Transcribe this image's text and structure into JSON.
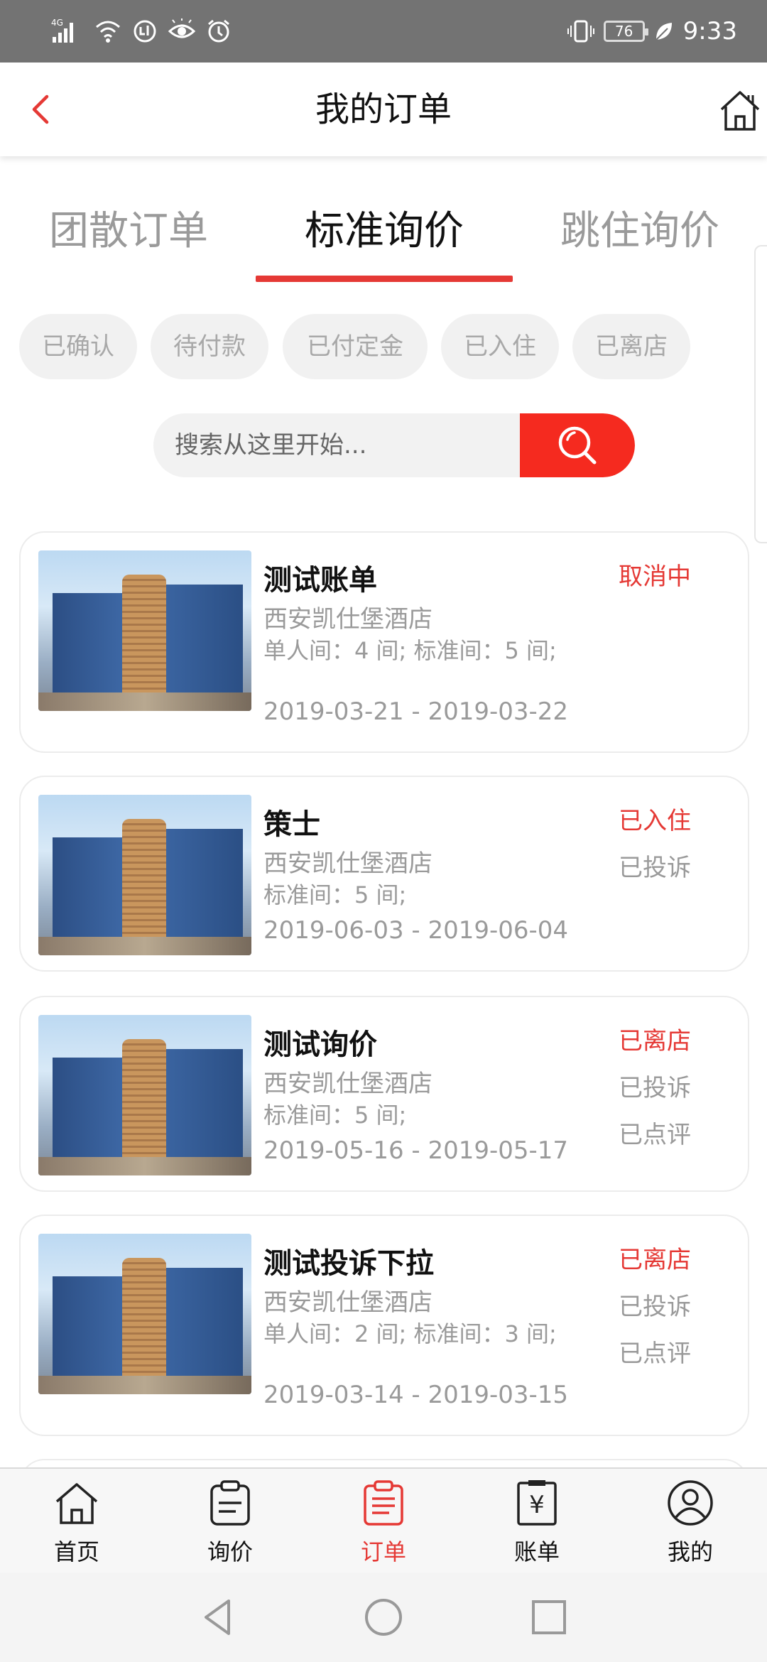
{
  "status_bar": {
    "network": "4G",
    "battery": "76",
    "time": "9:33",
    "icons": [
      "signal-icon",
      "wifi-icon",
      "data-saver-icon",
      "eye-comfort-icon",
      "alarm-icon",
      "vibrate-icon",
      "battery-icon",
      "leaf-icon"
    ]
  },
  "header": {
    "title": "我的订单",
    "back_icon": "back-arrow-icon",
    "home_icon": "home-icon"
  },
  "tabs": [
    {
      "label": "团散订单",
      "active": false
    },
    {
      "label": "标准询价",
      "active": true
    },
    {
      "label": "跳住询价",
      "active": false
    }
  ],
  "filters": [
    "已确认",
    "待付款",
    "已付定金",
    "已入住",
    "已离店"
  ],
  "search": {
    "placeholder": "搜索从这里开始...",
    "button_icon": "search-icon"
  },
  "orders": [
    {
      "title": "测试账单",
      "hotel": "西安凯仕堡酒店",
      "rooms": "单人间：4 间; 标准间：5 间;",
      "dates": "2019-03-21 - 2019-03-22",
      "status": [
        "取消中"
      ]
    },
    {
      "title": "策士",
      "hotel": "西安凯仕堡酒店",
      "rooms": "标准间：5 间;",
      "dates": "2019-06-03 - 2019-06-04",
      "status": [
        "已入住",
        "已投诉"
      ]
    },
    {
      "title": "测试询价",
      "hotel": "西安凯仕堡酒店",
      "rooms": "标准间：5 间;",
      "dates": "2019-05-16 - 2019-05-17",
      "status": [
        "已离店",
        "已投诉",
        "已点评"
      ]
    },
    {
      "title": "测试投诉下拉",
      "hotel": "西安凯仕堡酒店",
      "rooms": "单人间：2 间; 标准间：3 间;",
      "dates": "2019-03-14 - 2019-03-15",
      "status": [
        "已离店",
        "已投诉",
        "已点评"
      ]
    }
  ],
  "bottom_nav": [
    {
      "label": "首页",
      "icon": "home-icon",
      "active": false
    },
    {
      "label": "询价",
      "icon": "clipboard-icon",
      "active": false
    },
    {
      "label": "订单",
      "icon": "order-list-icon",
      "active": true
    },
    {
      "label": "账单",
      "icon": "bill-yuan-icon",
      "active": false
    },
    {
      "label": "我的",
      "icon": "user-icon",
      "active": false
    }
  ],
  "bill_symbol": "¥",
  "colors": {
    "accent": "#e53935",
    "search_button": "#f52a1f",
    "status_bar": "#737373",
    "muted_text": "#9a9a9a"
  }
}
